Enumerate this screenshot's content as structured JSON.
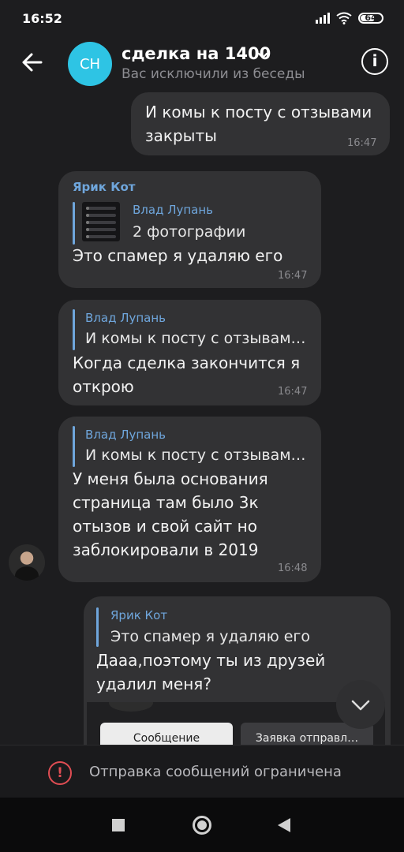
{
  "status": {
    "time": "16:52",
    "battery": "64",
    "icons": [
      "signal-icon",
      "wifi-icon",
      "battery-icon"
    ]
  },
  "header": {
    "avatar_initials": "CH",
    "title": "сделка на 1400",
    "subtitle": "Вас исключили из беседы"
  },
  "messages": [
    {
      "lines": [
        "И комы к посту с отзывами",
        "закрыты"
      ],
      "time": "16:47"
    },
    {
      "sender": "Ярик Кот",
      "reply_name": "Влад Лупань",
      "reply_text": "2 фотографии",
      "lines": [
        "Это спамер я удаляю его"
      ],
      "time": "16:47"
    },
    {
      "reply_name": "Влад Лупань",
      "reply_text": "И комы к посту с отзывам…",
      "lines": [
        "Когда сделка закончится я",
        "открою"
      ],
      "time": "16:47"
    },
    {
      "reply_name": "Влад Лупань",
      "reply_text": "И комы к посту с отзывам…",
      "lines": [
        "У меня была основания",
        "страница там было 3к",
        "отызов и свой сайт но",
        "заблокировали в 2019"
      ],
      "time": "16:48"
    },
    {
      "reply_name": "Ярик Кот",
      "reply_text": "Это спамер я удаляю его",
      "lines": [
        "Дааа,поэтому ты из друзей",
        "удалил меня?"
      ],
      "preview_buttons": [
        "Сообщение",
        "Заявка отправл…"
      ]
    }
  ],
  "footer": {
    "restricted_text": "Отправка сообщений ограничена"
  },
  "colors": {
    "accent": "#6fa6dc",
    "avatar": "#2ec4e4",
    "bubble": "#323234",
    "alert": "#e04d53"
  }
}
